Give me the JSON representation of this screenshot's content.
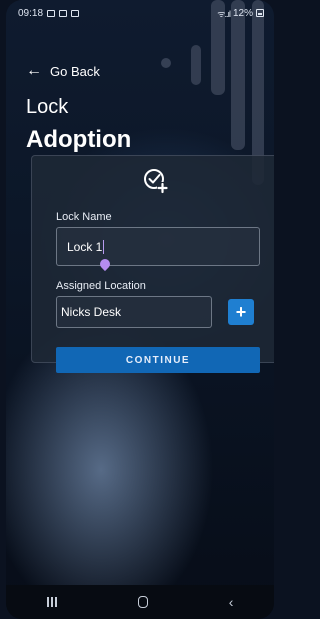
{
  "status_bar": {
    "time": "09:18",
    "battery": "12%"
  },
  "header": {
    "back_label": "Go Back",
    "title_line1": "Lock",
    "title_line2": "Adoption"
  },
  "form": {
    "lock_name_label": "Lock Name",
    "lock_name_value": "Lock 1",
    "assigned_location_label": "Assigned Location",
    "assigned_location_value": "Nicks Desk",
    "add_location_symbol": "+",
    "continue_label": "CONTINUE"
  },
  "icons": {
    "header_icon": "check-plus-icon",
    "back": "arrow-left-icon",
    "nav_recent": "recent-apps-icon",
    "nav_home": "home-icon",
    "nav_back": "back-chevron-icon"
  },
  "colors": {
    "accent": "#1167b5",
    "plus_button": "#1f7fd1",
    "cursor": "#b48cf0"
  }
}
